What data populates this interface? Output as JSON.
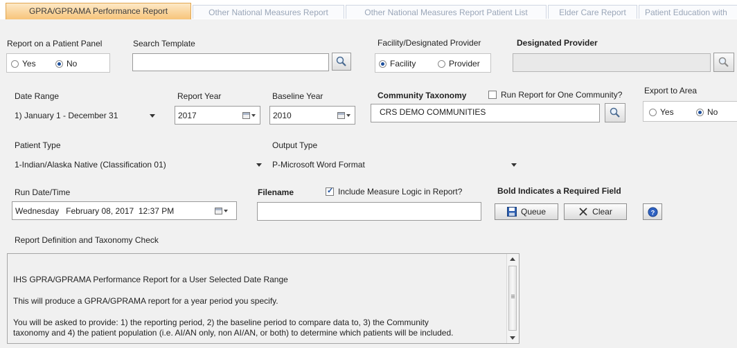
{
  "tabs": [
    {
      "label": "GPRA/GPRAMA Performance Report"
    },
    {
      "label": "Other National Measures Report"
    },
    {
      "label": "Other National Measures Report Patient List"
    },
    {
      "label": "Elder Care Report"
    },
    {
      "label": "Patient Education with"
    }
  ],
  "patient_panel": {
    "label": "Report on a Patient Panel",
    "yes": "Yes",
    "no": "No",
    "selected": "No"
  },
  "search_template": {
    "label": "Search Template",
    "value": ""
  },
  "facility_provider": {
    "label": "Facility/Designated Provider",
    "facility": "Facility",
    "provider": "Provider",
    "selected": "Facility"
  },
  "designated_provider": {
    "label": "Designated Provider",
    "value": ""
  },
  "date_range": {
    "label": "Date Range",
    "value": "1) January 1 - December 31"
  },
  "report_year": {
    "label": "Report Year",
    "value": "2017"
  },
  "baseline_year": {
    "label": "Baseline Year",
    "value": "2010"
  },
  "community_taxonomy": {
    "label": "Community Taxonomy",
    "value": "CRS DEMO COMMUNITIES",
    "one_community_label": "Run Report for One Community?",
    "one_community_checked": false
  },
  "export_area": {
    "label": "Export to Area",
    "yes": "Yes",
    "no": "No",
    "selected": "No"
  },
  "patient_type": {
    "label": "Patient Type",
    "value": "1-Indian/Alaska Native (Classification 01)"
  },
  "output_type": {
    "label": "Output Type",
    "value": "P-Microsoft Word Format"
  },
  "run_datetime": {
    "label": "Run Date/Time",
    "value": "Wednesday   February 08, 2017  12:37 PM"
  },
  "filename": {
    "label": "Filename",
    "value": ""
  },
  "include_logic": {
    "label": "Include Measure Logic in Report?",
    "checked": true
  },
  "required_note": "Bold Indicates a Required Field",
  "buttons": {
    "queue": "Queue",
    "clear": "Clear"
  },
  "definition": {
    "label": "Report Definition and Taxonomy Check",
    "lines": [
      "IHS GPRA/GPRAMA Performance Report for a User Selected Date Range",
      "This will produce a GPRA/GPRAMA report for a year period you specify.",
      "You will be asked to provide: 1) the reporting period, 2) the baseline period to compare data to, 3) the Community",
      "taxonomy and 4) the patient population (i.e. AI/AN only, non AI/AN, or both) to determine which patients will be included."
    ]
  },
  "icons": {
    "search": "magnifier-icon",
    "calendar": "calendar-icon",
    "save": "floppy-disk-icon",
    "clear": "x-icon",
    "help": "help-icon"
  }
}
